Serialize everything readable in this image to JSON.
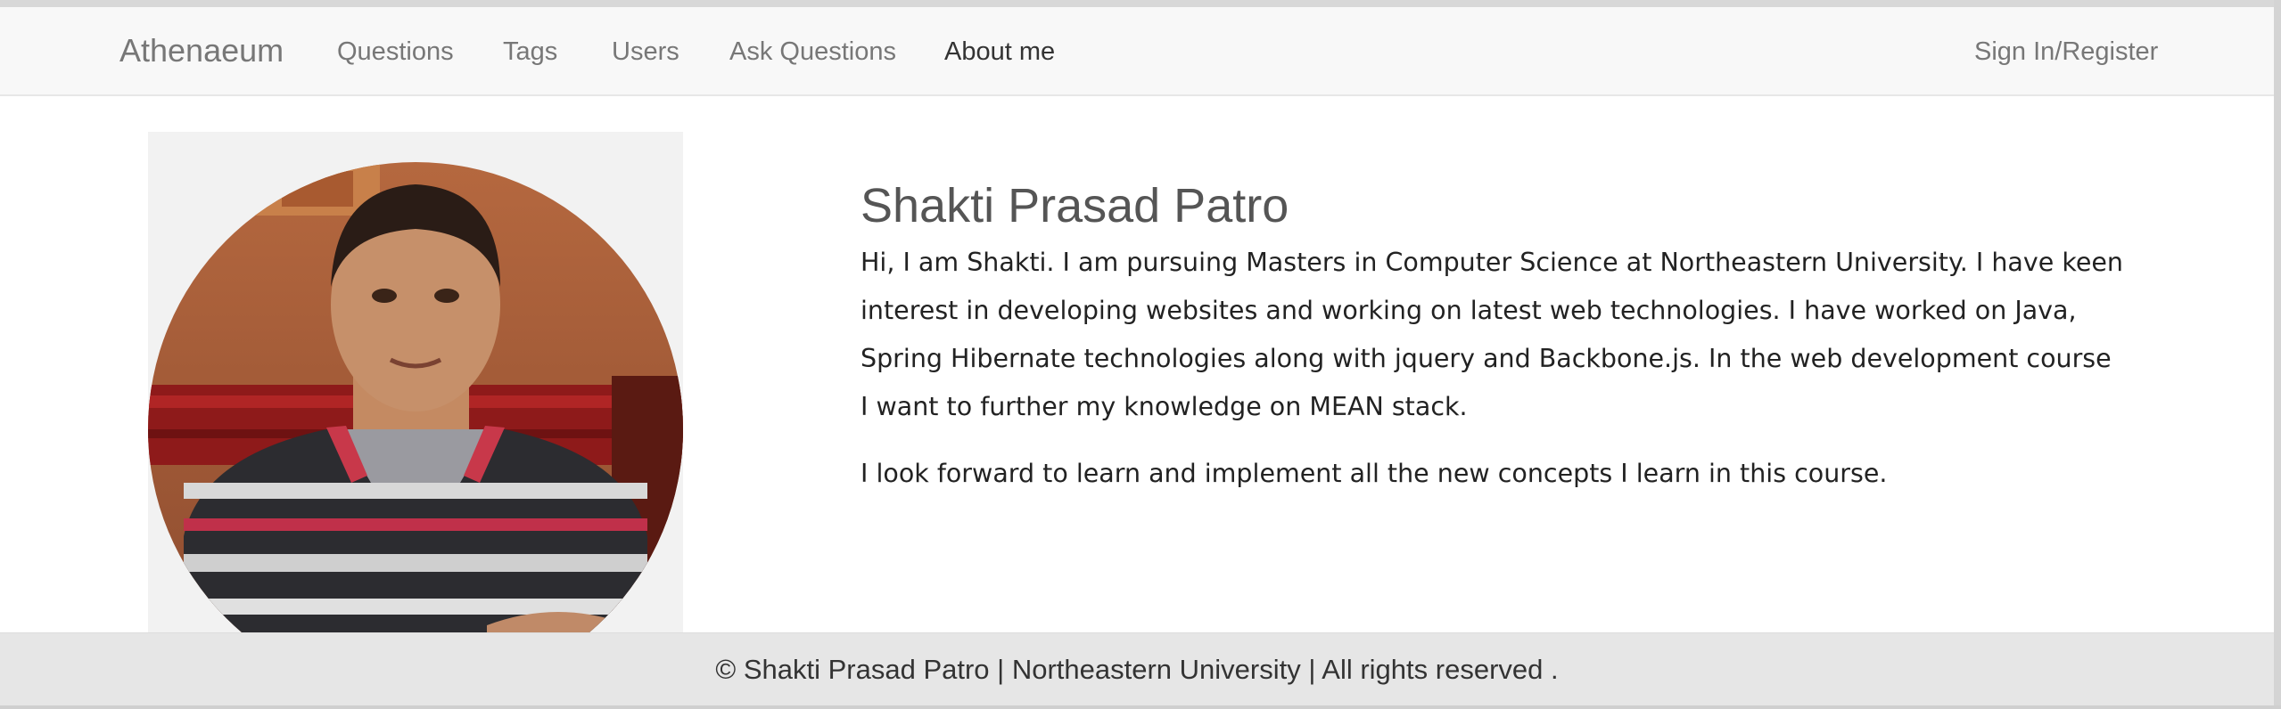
{
  "navbar": {
    "brand": "Athenaeum",
    "links": [
      {
        "label": "Questions"
      },
      {
        "label": "Tags"
      },
      {
        "label": "Users"
      },
      {
        "label": "Ask Questions"
      },
      {
        "label": "About me",
        "active": true
      }
    ],
    "signin": "Sign In/Register"
  },
  "profile": {
    "name": "Shakti Prasad Patro",
    "bio_paragraph_1": "Hi, I am Shakti. I am pursuing Masters in Computer Science at Northeastern University. I have keen interest in developing websites and working on latest web technologies. I have worked on Java, Spring Hibernate technologies along with jquery and Backbone.js. In the web development course I want to further my knowledge on MEAN stack.",
    "bio_paragraph_2": "I look forward to learn and implement all the new concepts I learn in this course."
  },
  "footer": {
    "text": "© Shakti Prasad Patro | Northeastern University | All rights reserved ."
  },
  "colors": {
    "navbar_bg": "#f8f8f8",
    "footer_bg": "#e6e6e6",
    "nav_text": "#777777",
    "nav_active": "#333333"
  }
}
